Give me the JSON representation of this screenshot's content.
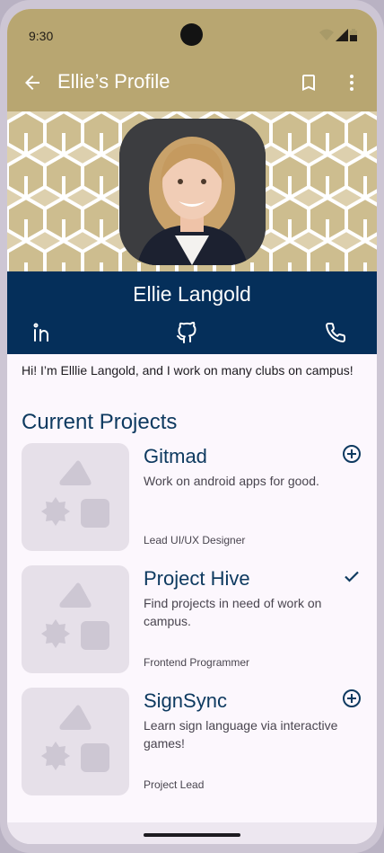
{
  "status": {
    "time": "9:30"
  },
  "appbar": {
    "title": "Ellie’s Profile",
    "back_icon": "arrow-back-icon",
    "bookmark_icon": "bookmark-icon",
    "menu_icon": "more-vert-icon"
  },
  "profile": {
    "name": "Ellie Langold",
    "bio": "Hi! I’m Elllie Langold, and I work on many clubs on campus!",
    "social": [
      "linkedin-icon",
      "github-icon",
      "phone-icon"
    ]
  },
  "projects": {
    "title": "Current Projects",
    "items": [
      {
        "name": "Gitmad",
        "description": "Work on android apps for good.",
        "role": "Lead UI/UX Designer",
        "action": "add-circle-icon"
      },
      {
        "name": "Project Hive",
        "description": "Find projects in need of work on campus.",
        "role": "Frontend Programmer",
        "action": "check-icon"
      },
      {
        "name": "SignSync",
        "description": "Learn sign language via interactive games!",
        "role": "Project Lead",
        "action": "add-circle-icon"
      }
    ]
  },
  "colors": {
    "header": "#b8a671",
    "namebar": "#052f5a",
    "accent": "#0e3a60",
    "background": "#fcf7fd"
  }
}
